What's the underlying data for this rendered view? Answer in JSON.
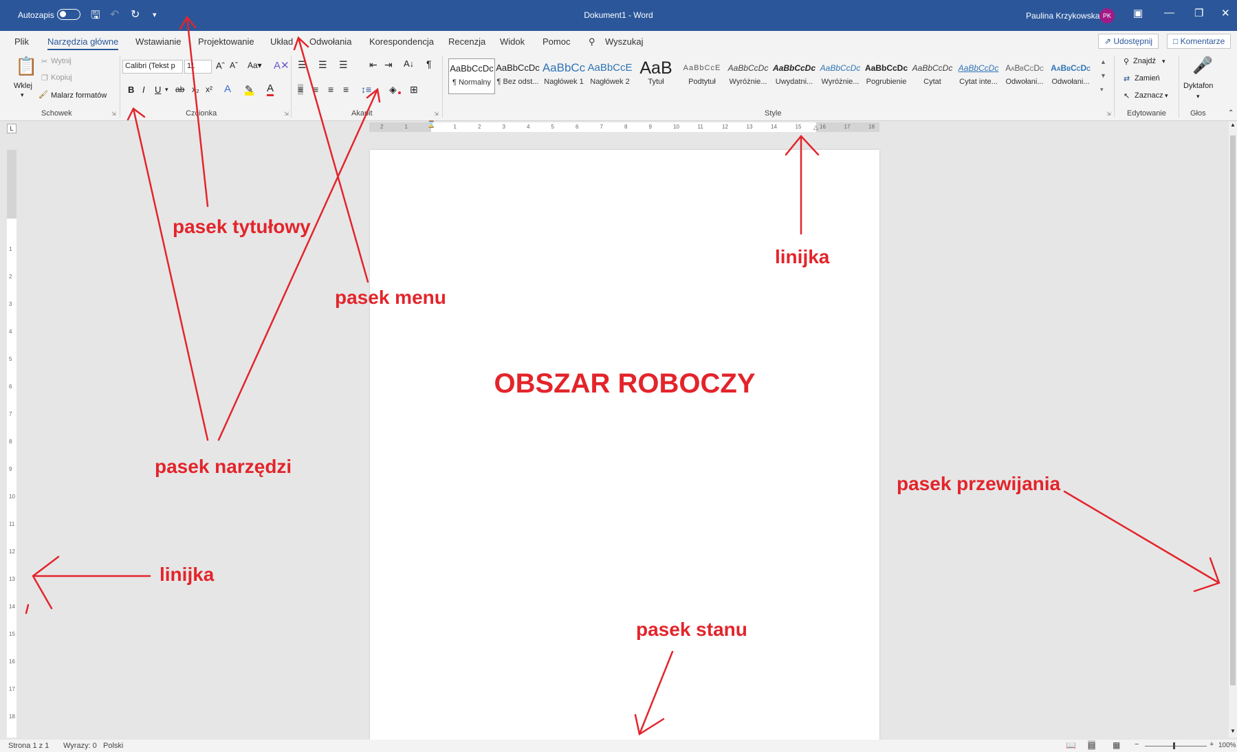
{
  "window": {
    "autosave_label": "Autozapis",
    "title": "Dokument1 - Word",
    "user_name": "Paulina Krzykowska",
    "user_initials": "PK"
  },
  "menu": {
    "tabs": [
      "Plik",
      "Narzędzia główne",
      "Wstawianie",
      "Projektowanie",
      "Układ",
      "Odwołania",
      "Korespondencja",
      "Recenzja",
      "Widok",
      "Pomoc"
    ],
    "search_placeholder": "Wyszukaj",
    "share_label": "Udostępnij",
    "comments_label": "Komentarze"
  },
  "ribbon": {
    "clipboard": {
      "paste": "Wklej",
      "cut": "Wytnij",
      "copy": "Kopiuj",
      "format_painter": "Malarz formatów",
      "group": "Schowek"
    },
    "font": {
      "font_name": "Calibri (Tekst p",
      "font_size": "11",
      "group": "Czcionka"
    },
    "paragraph": {
      "group": "Akapit"
    },
    "styles": {
      "items": [
        {
          "sample": "AaBbCcDc",
          "name": "¶ Normalny"
        },
        {
          "sample": "AaBbCcDc",
          "name": "¶ Bez odst..."
        },
        {
          "sample": "AaBbCc",
          "name": "Nagłówek 1"
        },
        {
          "sample": "AaBbCcE",
          "name": "Nagłówek 2"
        },
        {
          "sample": "AaB",
          "name": "Tytuł"
        },
        {
          "sample": "AaBbCcE",
          "name": "Podtytuł"
        },
        {
          "sample": "AaBbCcDc",
          "name": "Wyróżnie..."
        },
        {
          "sample": "AaBbCcDc",
          "name": "Uwydatni..."
        },
        {
          "sample": "AaBbCcDc",
          "name": "Wyróżnie..."
        },
        {
          "sample": "AaBbCcDc",
          "name": "Pogrubienie"
        },
        {
          "sample": "AaBbCcDc",
          "name": "Cytat"
        },
        {
          "sample": "AaBbCcDc",
          "name": "Cytat inte..."
        },
        {
          "sample": "AaBbCcDc",
          "name": "Odwołani..."
        },
        {
          "sample": "AaBbCcDc",
          "name": "Odwołani..."
        }
      ],
      "group": "Style"
    },
    "editing": {
      "find": "Znajdź",
      "replace": "Zamień",
      "select": "Zaznacz",
      "group": "Edytowanie"
    },
    "voice": {
      "dictate": "Dyktafon",
      "group": "Głos"
    }
  },
  "document": {
    "work_area_label": "OBSZAR ROBOCZY"
  },
  "status": {
    "page": "Strona 1 z 1",
    "words": "Wyrazy: 0",
    "language": "Polski",
    "zoom": "100%"
  },
  "annotations": {
    "title_bar": "pasek tytułowy",
    "menu_bar": "pasek menu",
    "toolbar": "pasek narzędzi",
    "ruler_top": "linijka",
    "ruler_left": "linijka",
    "scrollbar": "pasek przewijania",
    "status_bar": "pasek stanu"
  }
}
